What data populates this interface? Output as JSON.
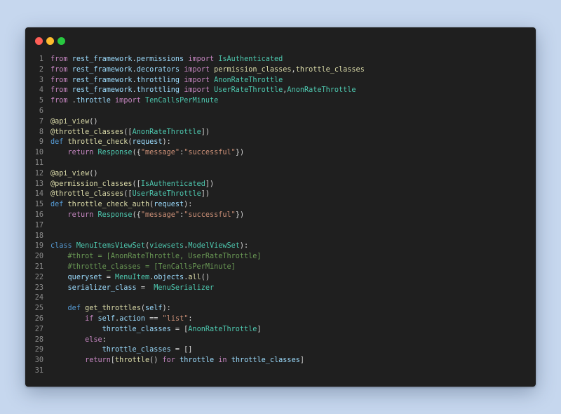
{
  "window": {
    "controls": [
      "close",
      "minimize",
      "maximize"
    ],
    "colors": {
      "background": "#1f1f1f",
      "close": "#ff5f57",
      "minimize": "#febc2e",
      "maximize": "#28c840"
    }
  },
  "editor": {
    "language": "python",
    "lines": [
      {
        "n": "1",
        "tokens": [
          [
            "kw",
            "from"
          ],
          [
            "op",
            " "
          ],
          [
            "var",
            "rest_framework"
          ],
          [
            "op",
            "."
          ],
          [
            "var",
            "permissions"
          ],
          [
            "op",
            " "
          ],
          [
            "kw",
            "import"
          ],
          [
            "op",
            " "
          ],
          [
            "cls",
            "IsAuthenticated"
          ]
        ]
      },
      {
        "n": "2",
        "tokens": [
          [
            "kw",
            "from"
          ],
          [
            "op",
            " "
          ],
          [
            "var",
            "rest_framework"
          ],
          [
            "op",
            "."
          ],
          [
            "var",
            "decorators"
          ],
          [
            "op",
            " "
          ],
          [
            "kw",
            "import"
          ],
          [
            "op",
            " "
          ],
          [
            "fn",
            "permission_classes"
          ],
          [
            "op",
            ","
          ],
          [
            "fn",
            "throttle_classes"
          ]
        ]
      },
      {
        "n": "3",
        "tokens": [
          [
            "kw",
            "from"
          ],
          [
            "op",
            " "
          ],
          [
            "var",
            "rest_framework"
          ],
          [
            "op",
            "."
          ],
          [
            "var",
            "throttling"
          ],
          [
            "op",
            " "
          ],
          [
            "kw",
            "import"
          ],
          [
            "op",
            " "
          ],
          [
            "cls",
            "AnonRateThrottle"
          ]
        ]
      },
      {
        "n": "4",
        "tokens": [
          [
            "kw",
            "from"
          ],
          [
            "op",
            " "
          ],
          [
            "var",
            "rest_framework"
          ],
          [
            "op",
            "."
          ],
          [
            "var",
            "throttling"
          ],
          [
            "op",
            " "
          ],
          [
            "kw",
            "import"
          ],
          [
            "op",
            " "
          ],
          [
            "cls",
            "UserRateThrottle"
          ],
          [
            "op",
            ","
          ],
          [
            "cls",
            "AnonRateThrottle"
          ]
        ]
      },
      {
        "n": "5",
        "tokens": [
          [
            "kw",
            "from"
          ],
          [
            "op",
            " ."
          ],
          [
            "var",
            "throttle"
          ],
          [
            "op",
            " "
          ],
          [
            "kw",
            "import"
          ],
          [
            "op",
            " "
          ],
          [
            "cls",
            "TenCallsPerMinute"
          ]
        ]
      },
      {
        "n": "6",
        "tokens": []
      },
      {
        "n": "7",
        "tokens": [
          [
            "fn",
            "@api_view"
          ],
          [
            "op",
            "()"
          ]
        ]
      },
      {
        "n": "8",
        "tokens": [
          [
            "fn",
            "@throttle_classes"
          ],
          [
            "op",
            "(["
          ],
          [
            "cls",
            "AnonRateThrottle"
          ],
          [
            "op",
            "])"
          ]
        ]
      },
      {
        "n": "9",
        "tokens": [
          [
            "def",
            "def"
          ],
          [
            "op",
            " "
          ],
          [
            "fn",
            "throttle_check"
          ],
          [
            "op",
            "("
          ],
          [
            "var",
            "request"
          ],
          [
            "op",
            "):"
          ]
        ]
      },
      {
        "n": "10",
        "tokens": [
          [
            "op",
            "    "
          ],
          [
            "kw",
            "return"
          ],
          [
            "op",
            " "
          ],
          [
            "cls",
            "Response"
          ],
          [
            "op",
            "({"
          ],
          [
            "str",
            "\"message\""
          ],
          [
            "op",
            ":"
          ],
          [
            "str",
            "\"successful\""
          ],
          [
            "op",
            "})"
          ]
        ]
      },
      {
        "n": "11",
        "tokens": []
      },
      {
        "n": "12",
        "tokens": [
          [
            "fn",
            "@api_view"
          ],
          [
            "op",
            "()"
          ]
        ]
      },
      {
        "n": "13",
        "tokens": [
          [
            "fn",
            "@permission_classes"
          ],
          [
            "op",
            "(["
          ],
          [
            "cls",
            "IsAuthenticated"
          ],
          [
            "op",
            "])"
          ]
        ]
      },
      {
        "n": "14",
        "tokens": [
          [
            "fn",
            "@throttle_classes"
          ],
          [
            "op",
            "(["
          ],
          [
            "cls",
            "UserRateThrottle"
          ],
          [
            "op",
            "])"
          ]
        ]
      },
      {
        "n": "15",
        "tokens": [
          [
            "def",
            "def"
          ],
          [
            "op",
            " "
          ],
          [
            "fn",
            "throttle_check_auth"
          ],
          [
            "op",
            "("
          ],
          [
            "var",
            "request"
          ],
          [
            "op",
            "):"
          ]
        ]
      },
      {
        "n": "16",
        "tokens": [
          [
            "op",
            "    "
          ],
          [
            "kw",
            "return"
          ],
          [
            "op",
            " "
          ],
          [
            "cls",
            "Response"
          ],
          [
            "op",
            "({"
          ],
          [
            "str",
            "\"message\""
          ],
          [
            "op",
            ":"
          ],
          [
            "str",
            "\"successful\""
          ],
          [
            "op",
            "})"
          ]
        ]
      },
      {
        "n": "17",
        "tokens": []
      },
      {
        "n": "18",
        "tokens": []
      },
      {
        "n": "19",
        "tokens": [
          [
            "def",
            "class"
          ],
          [
            "op",
            " "
          ],
          [
            "cls",
            "MenuItemsViewSet"
          ],
          [
            "op",
            "("
          ],
          [
            "cls",
            "viewsets"
          ],
          [
            "op",
            "."
          ],
          [
            "cls",
            "ModelViewSet"
          ],
          [
            "op",
            "):"
          ]
        ]
      },
      {
        "n": "20",
        "tokens": [
          [
            "op",
            "    "
          ],
          [
            "cm",
            "#throt = [AnonRateThrottle, UserRateThrottle]"
          ]
        ]
      },
      {
        "n": "21",
        "tokens": [
          [
            "op",
            "    "
          ],
          [
            "cm",
            "#throttle_classes = [TenCallsPerMinute]"
          ]
        ]
      },
      {
        "n": "22",
        "tokens": [
          [
            "op",
            "    "
          ],
          [
            "var",
            "queryset"
          ],
          [
            "op",
            " = "
          ],
          [
            "cls",
            "MenuItem"
          ],
          [
            "op",
            "."
          ],
          [
            "var",
            "objects"
          ],
          [
            "op",
            "."
          ],
          [
            "fn",
            "all"
          ],
          [
            "op",
            "()"
          ]
        ]
      },
      {
        "n": "23",
        "tokens": [
          [
            "op",
            "    "
          ],
          [
            "var",
            "serializer_class"
          ],
          [
            "op",
            " =  "
          ],
          [
            "cls",
            "MenuSerializer"
          ]
        ]
      },
      {
        "n": "24",
        "tokens": []
      },
      {
        "n": "25",
        "tokens": [
          [
            "op",
            "    "
          ],
          [
            "def",
            "def"
          ],
          [
            "op",
            " "
          ],
          [
            "fn",
            "get_throttles"
          ],
          [
            "op",
            "("
          ],
          [
            "var",
            "self"
          ],
          [
            "op",
            "):"
          ]
        ]
      },
      {
        "n": "26",
        "tokens": [
          [
            "op",
            "        "
          ],
          [
            "kw",
            "if"
          ],
          [
            "op",
            " "
          ],
          [
            "var",
            "self"
          ],
          [
            "op",
            "."
          ],
          [
            "var",
            "action"
          ],
          [
            "op",
            " == "
          ],
          [
            "str",
            "\"list\""
          ],
          [
            "op",
            ":"
          ]
        ]
      },
      {
        "n": "27",
        "tokens": [
          [
            "op",
            "            "
          ],
          [
            "var",
            "throttle_classes"
          ],
          [
            "op",
            " = ["
          ],
          [
            "cls",
            "AnonRateThrottle"
          ],
          [
            "op",
            "]"
          ]
        ]
      },
      {
        "n": "28",
        "tokens": [
          [
            "op",
            "        "
          ],
          [
            "kw",
            "else"
          ],
          [
            "op",
            ":"
          ]
        ]
      },
      {
        "n": "29",
        "tokens": [
          [
            "op",
            "            "
          ],
          [
            "var",
            "throttle_classes"
          ],
          [
            "op",
            " = []"
          ]
        ]
      },
      {
        "n": "30",
        "tokens": [
          [
            "op",
            "        "
          ],
          [
            "kw",
            "return"
          ],
          [
            "op",
            "["
          ],
          [
            "fn",
            "throttle"
          ],
          [
            "op",
            "() "
          ],
          [
            "kw",
            "for"
          ],
          [
            "op",
            " "
          ],
          [
            "var",
            "throttle"
          ],
          [
            "op",
            " "
          ],
          [
            "kw",
            "in"
          ],
          [
            "op",
            " "
          ],
          [
            "var",
            "throttle_classes"
          ],
          [
            "op",
            "]"
          ]
        ]
      },
      {
        "n": "31",
        "tokens": []
      }
    ]
  }
}
